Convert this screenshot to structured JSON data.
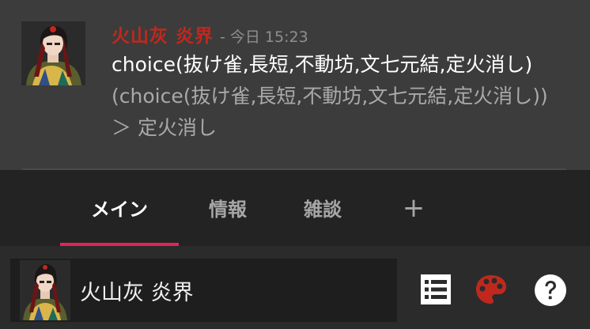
{
  "message": {
    "author": "火山灰 炎界",
    "separator": "-",
    "timestamp": "今日 15:23",
    "command": "choice(抜け雀,長短,不動坊,文七元結,定火消し)",
    "result": " (choice(抜け雀,長短,不動坊,文七元結,定火消し)) ＞ 定火消し"
  },
  "tabs": [
    {
      "label": "メイン",
      "active": true
    },
    {
      "label": "情報",
      "active": false
    },
    {
      "label": "雑談",
      "active": false
    }
  ],
  "add_tab_label": "+",
  "input": {
    "character_name": "火山灰 炎界"
  },
  "icons": {
    "list": "list-icon",
    "palette": "palette-icon",
    "help": "help-icon"
  },
  "colors": {
    "author": "#c0281e",
    "tab_indicator": "#e0245e",
    "palette": "#c0281e"
  }
}
